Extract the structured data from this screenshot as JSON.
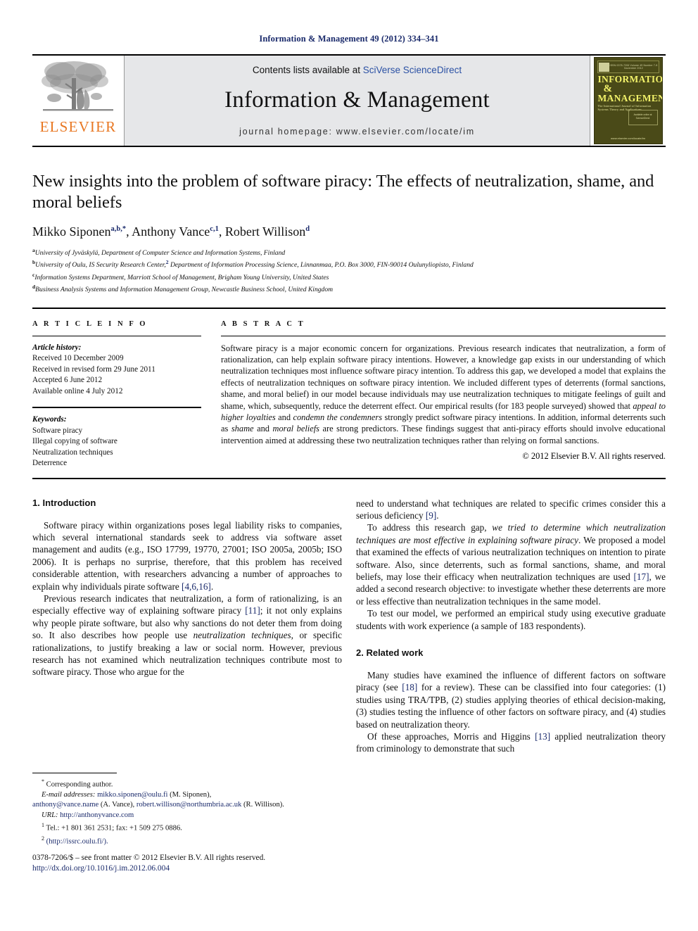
{
  "running_head": "Information & Management 49 (2012) 334–341",
  "masthead": {
    "contents_prefix": "Contents lists available at ",
    "sciencedirect": "SciVerse ScienceDirect",
    "journal_title": "Information & Management",
    "homepage": "journal homepage: www.elsevier.com/locate/im",
    "publisher_logo_text": "ELSEVIER",
    "cover": {
      "top_text": "ISSN 0378-7206  Volume 49 Number 7-8 November 2012",
      "line1": "INFORMATION",
      "amp": "&",
      "line2": "MANAGEMENT",
      "subtitle": "The International Journal of Information Systems Theory and Applications",
      "badge_text": "Available online at ScienceDirect",
      "url": "www.elsevier.com/locate/im"
    }
  },
  "article": {
    "title": "New insights into the problem of software piracy: The effects of neutralization, shame, and moral beliefs",
    "authors": [
      {
        "name": "Mikko Siponen",
        "sup": "a,b,*"
      },
      {
        "name": "Anthony Vance",
        "sup": "c,1"
      },
      {
        "name": "Robert Willison",
        "sup": "d"
      }
    ],
    "affiliations": [
      {
        "marker": "a",
        "text": "University of Jyväskylä, Department of Computer Science and Information Systems, Finland"
      },
      {
        "marker": "b",
        "text_before": "University of Oulu, IS Security Research Center,",
        "inline_sup": "2",
        "text_after": " Department of Information Processing Science, Linnanmaa, P.O. Box 3000, FIN-90014 Oulunyliopisto, Finland"
      },
      {
        "marker": "c",
        "text": "Information Systems Department, Marriott School of Management, Brigham Young University, United States"
      },
      {
        "marker": "d",
        "text": "Business Analysis Systems and Information Management Group, Newcastle Business School, United Kingdom"
      }
    ]
  },
  "article_info": {
    "label": "A R T I C L E   I N F O",
    "history_label": "Article history:",
    "history": [
      "Received 10 December 2009",
      "Received in revised form 29 June 2011",
      "Accepted 6 June 2012",
      "Available online 4 July 2012"
    ],
    "keywords_label": "Keywords:",
    "keywords": [
      "Software piracy",
      "Illegal copying of software",
      "Neutralization techniques",
      "Deterrence"
    ]
  },
  "abstract": {
    "label": "A B S T R A C T",
    "part1": "Software piracy is a major economic concern for organizations. Previous research indicates that neutralization, a form of rationalization, can help explain software piracy intentions. However, a knowledge gap exists in our understanding of which neutralization techniques most influence software piracy intention. To address this gap, we developed a model that explains the effects of neutralization techniques on software piracy intention. We included different types of deterrents (formal sanctions, shame, and moral belief) in our model because individuals may use neutralization techniques to mitigate feelings of guilt and shame, which, subsequently, reduce the deterrent effect. Our empirical results (for 183 people surveyed) showed that ",
    "ital1": "appeal to higher loyalties",
    "mid1": " and ",
    "ital2": "condemn the condemners",
    "part2": " strongly predict software piracy intentions. In addition, informal deterrents such as ",
    "ital3": "shame",
    "mid2": " and ",
    "ital4": "moral beliefs",
    "part3": " are strong predictors. These findings suggest that anti-piracy efforts should involve educational intervention aimed at addressing these two neutralization techniques rather than relying on formal sanctions.",
    "copyright": "© 2012 Elsevier B.V. All rights reserved."
  },
  "sections": {
    "intro_title": "1. Introduction",
    "intro_p1": "Software piracy within organizations poses legal liability risks to companies, which several international standards seek to address via software asset management and audits (e.g., ISO 17799, 19770, 27001; ISO 2005a, 2005b; ISO 2006). It is perhaps no surprise, therefore, that this problem has received considerable attention, with researchers advancing a number of approaches to explain why individuals pirate software ",
    "intro_p1_ref": "[4,6,16]",
    "intro_p1_end": ".",
    "intro_p2_a": "Previous research indicates that neutralization, a form of rationalizing, is an especially effective way of explaining software piracy ",
    "intro_p2_ref": "[11]",
    "intro_p2_b": "; it not only explains why people pirate software, but also why sanctions do not deter them from doing so. It also describes how people use ",
    "intro_p2_ital": "neutralization techniques",
    "intro_p2_c": ", or specific rationalizations, to justify breaking a law or social norm. However, previous research has not examined which neutralization techniques contribute most to software piracy. Those who argue for the",
    "right_p1_a": "need to understand what techniques are related to specific crimes consider this a serious deficiency ",
    "right_p1_ref": "[9]",
    "right_p1_b": ".",
    "right_p2_a": "To address this research gap, ",
    "right_p2_ital": "we tried to determine which neutralization techniques are most effective in explaining software piracy",
    "right_p2_b": ". We proposed a model that examined the effects of various neutralization techniques on intention to pirate software. Also, since deterrents, such as formal sanctions, shame, and moral beliefs, may lose their efficacy when neutralization techniques are used ",
    "right_p2_ref": "[17]",
    "right_p2_c": ", we added a second research objective: to investigate whether these deterrents are more or less effective than neutralization techniques in the same model.",
    "right_p3": "To test our model, we performed an empirical study using executive graduate students with work experience (a sample of 183 respondents).",
    "related_title": "2. Related work",
    "related_p1_a": "Many studies have examined the influence of different factors on software piracy (see ",
    "related_p1_ref": "[18]",
    "related_p1_b": " for a review). These can be classified into four categories: (1) studies using TRA/TPB, (2) studies applying theories of ethical decision-making, (3) studies testing the influence of other factors on software piracy, and (4) studies based on neutralization theory.",
    "related_p2_a": "Of these approaches, Morris and Higgins ",
    "related_p2_ref": "[13]",
    "related_p2_b": " applied neutralization theory from criminology to demonstrate that such"
  },
  "footnotes": {
    "corresponding": "Corresponding author.",
    "email_label": "E-mail addresses:",
    "email1": "mikko.siponen@oulu.fi",
    "email1_name": " (M. Siponen),",
    "email2": "anthony@vance.name",
    "email2_name": " (A. Vance),",
    "email3": "robert.willison@northumbria.ac.uk",
    "email3_name": " (R. Willison).",
    "url_label": "URL:",
    "url_value": "http://anthonyvance.com",
    "note1_marker": "1",
    "note1": "Tel.: +1 801 361 2531; fax: +1 509 275 0886.",
    "note2_marker": "2",
    "note2_open": "(",
    "note2_url": "http://issrc.oulu.fi/",
    "note2_close": ")."
  },
  "footer": {
    "front_matter": "0378-7206/$ – see front matter © 2012 Elsevier B.V. All rights reserved.",
    "doi": "http://dx.doi.org/10.1016/j.im.2012.06.004"
  },
  "colors": {
    "link_blue": "#1a2a6b",
    "sciencedirect_blue": "#2b51a4",
    "elsevier_orange": "#E87722",
    "masthead_gray": "#e6e7e9",
    "cover_olive": "#4a4a18",
    "cover_yellow": "#f2f26a"
  }
}
